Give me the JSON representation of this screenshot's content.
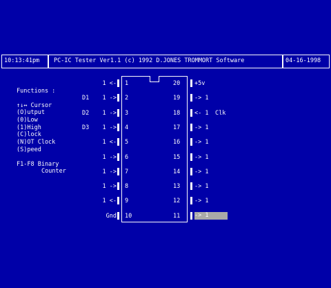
{
  "header": {
    "time": "10:13:41pm",
    "title": "PC-IC Tester Ver1.1 (c) 1992 D.JONES TROMMORT Software",
    "date": "04-16-1998"
  },
  "help": {
    "heading": "Functions :",
    "items": [
      "↑↓↔ Cursor",
      "(O)utput",
      "(0)Low",
      "(1)High",
      "(C)lock",
      "(N)OT Clock",
      "(S)peed"
    ],
    "fkeys_line1": "F1-F8 Binary",
    "fkeys_line2": "Counter"
  },
  "chip": {
    "left_pins": [
      {
        "label": "",
        "value": "1",
        "dir": "<-",
        "num": "1"
      },
      {
        "label": "D1",
        "value": "1",
        "dir": "->",
        "num": "2"
      },
      {
        "label": "D2",
        "value": "1",
        "dir": "->",
        "num": "3"
      },
      {
        "label": "D3",
        "value": "1",
        "dir": "->",
        "num": "4"
      },
      {
        "label": "",
        "value": "1",
        "dir": "<-",
        "num": "5"
      },
      {
        "label": "",
        "value": "1",
        "dir": "->",
        "num": "6"
      },
      {
        "label": "",
        "value": "1",
        "dir": "->",
        "num": "7"
      },
      {
        "label": "",
        "value": "1",
        "dir": "->",
        "num": "8"
      },
      {
        "label": "",
        "value": "1",
        "dir": "<-",
        "num": "9"
      },
      {
        "label": "",
        "value": "Gnd",
        "dir": "",
        "num": "10"
      }
    ],
    "right_pins": [
      {
        "num": "20",
        "dir": "",
        "value": "+5v",
        "label": ""
      },
      {
        "num": "19",
        "dir": "->",
        "value": "1",
        "label": ""
      },
      {
        "num": "18",
        "dir": "<-",
        "value": "1",
        "label": "Clk"
      },
      {
        "num": "17",
        "dir": "->",
        "value": "1",
        "label": ""
      },
      {
        "num": "16",
        "dir": "->",
        "value": "1",
        "label": ""
      },
      {
        "num": "15",
        "dir": "->",
        "value": "1",
        "label": ""
      },
      {
        "num": "14",
        "dir": "->",
        "value": "1",
        "label": ""
      },
      {
        "num": "13",
        "dir": "->",
        "value": "1",
        "label": ""
      },
      {
        "num": "12",
        "dir": "->",
        "value": "1",
        "label": ""
      },
      {
        "num": "11",
        "dir": "->",
        "value": "1",
        "label": ""
      }
    ],
    "selected_pin": "11"
  },
  "colors": {
    "background": "#0000a8",
    "foreground": "#fcfcfc",
    "highlight": "#a8a8a8"
  }
}
